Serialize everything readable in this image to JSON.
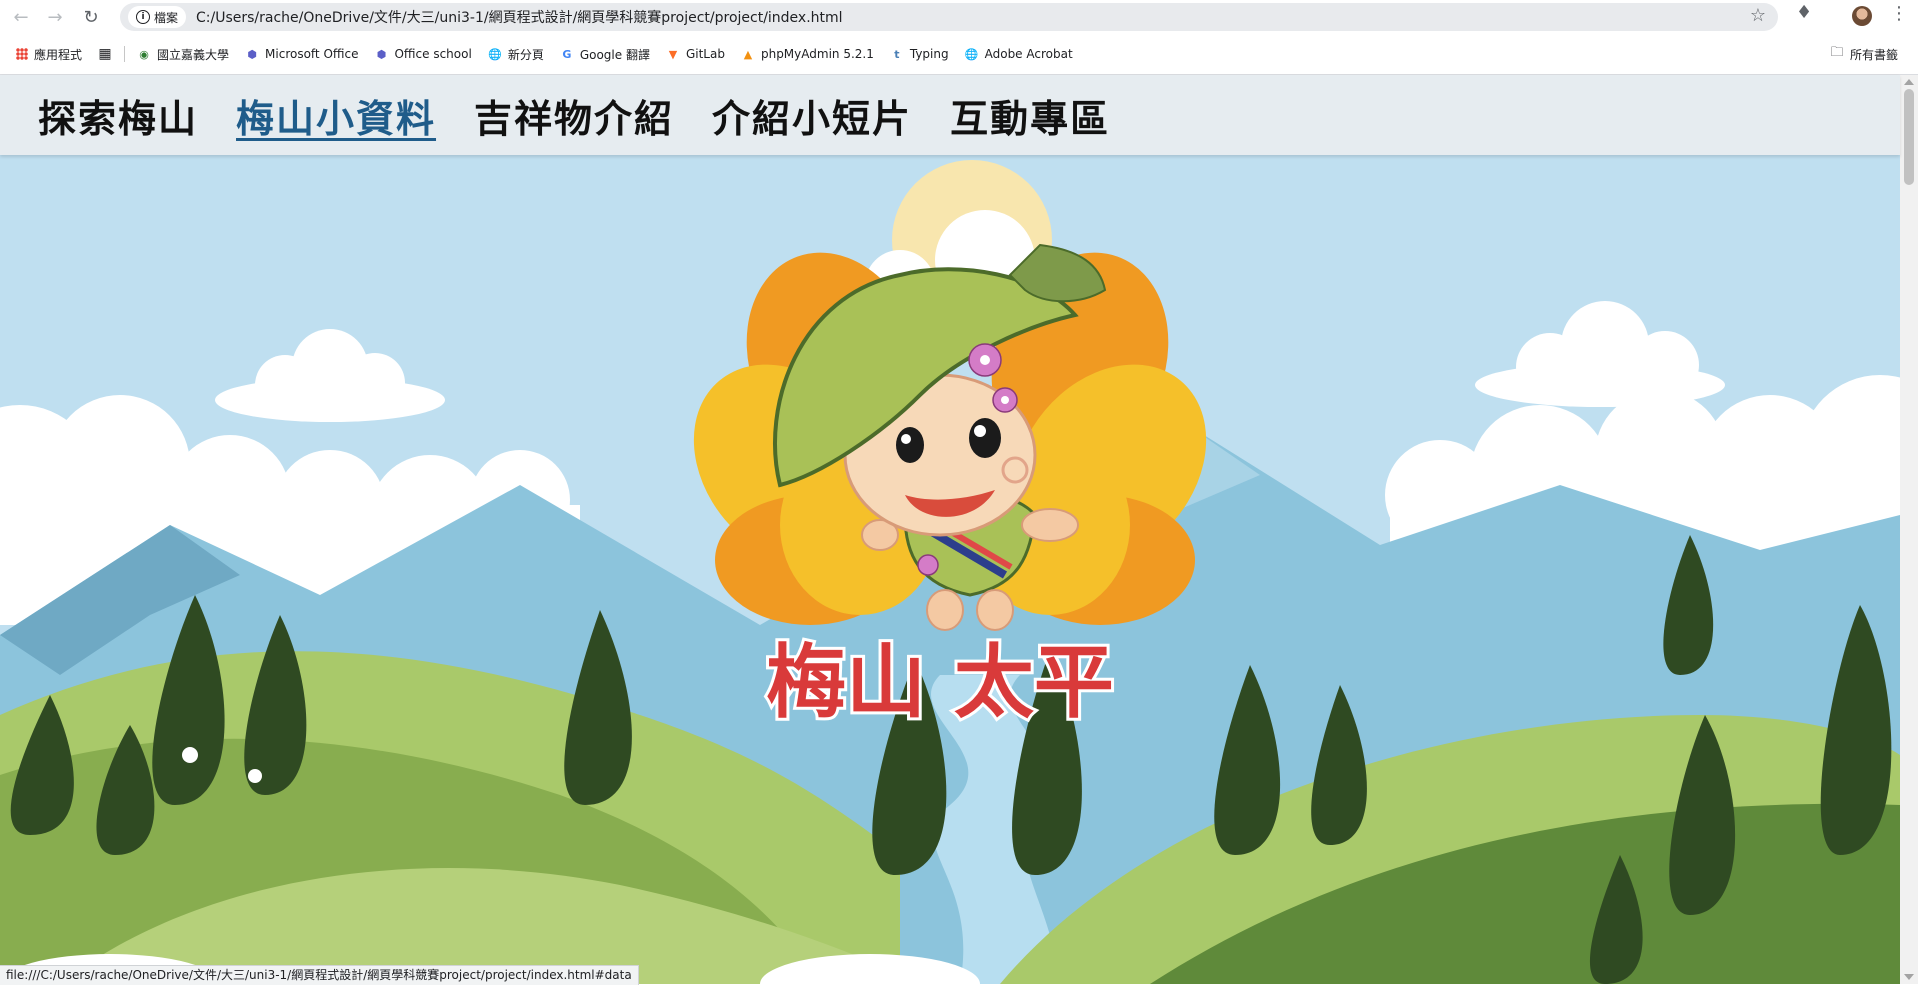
{
  "browser": {
    "site_chip": "檔案",
    "url": "C:/Users/rache/OneDrive/文件/大三/uni3-1/網頁程式設計/網頁學科競賽project/project/index.html",
    "bookmarks": [
      {
        "label": "應用程式",
        "icon": "apps-icon"
      },
      {
        "label": "",
        "icon": "grid-icon"
      },
      {
        "label": "國立嘉義大學",
        "icon": "university-icon"
      },
      {
        "label": "Microsoft Office",
        "icon": "office-icon"
      },
      {
        "label": "Office school",
        "icon": "office-icon"
      },
      {
        "label": "新分頁",
        "icon": "globe-icon"
      },
      {
        "label": "Google 翻譯",
        "icon": "translate-icon"
      },
      {
        "label": "GitLab",
        "icon": "gitlab-icon"
      },
      {
        "label": "phpMyAdmin 5.2.1",
        "icon": "phpmyadmin-icon"
      },
      {
        "label": "Typing",
        "icon": "typing-icon"
      },
      {
        "label": "Adobe Acrobat",
        "icon": "globe-icon"
      }
    ],
    "all_bookmarks": "所有書籤",
    "status_url": "file:///C:/Users/rache/OneDrive/文件/大三/uni3-1/網頁程式設計/網頁學科競賽project/project/index.html#data"
  },
  "nav": {
    "items": [
      "探索梅山",
      "梅山小資料",
      "吉祥物介紹",
      "介紹小短片",
      "互動專區"
    ],
    "active_index": 1
  },
  "hero": {
    "title": "梅山 太平"
  },
  "colors": {
    "sky": "#bfdff0",
    "mountain": "#8cc4dc",
    "hill_light": "#a9c96a",
    "hill_dark": "#5f8a3a",
    "tree": "#2f4a22",
    "petal_orange": "#f09a22",
    "petal_yellow": "#f5c02a",
    "leaf_green": "#a9c157",
    "title_red": "#d93a3a",
    "nav_bg": "#e6ecf0",
    "nav_active": "#1f5c8a"
  }
}
